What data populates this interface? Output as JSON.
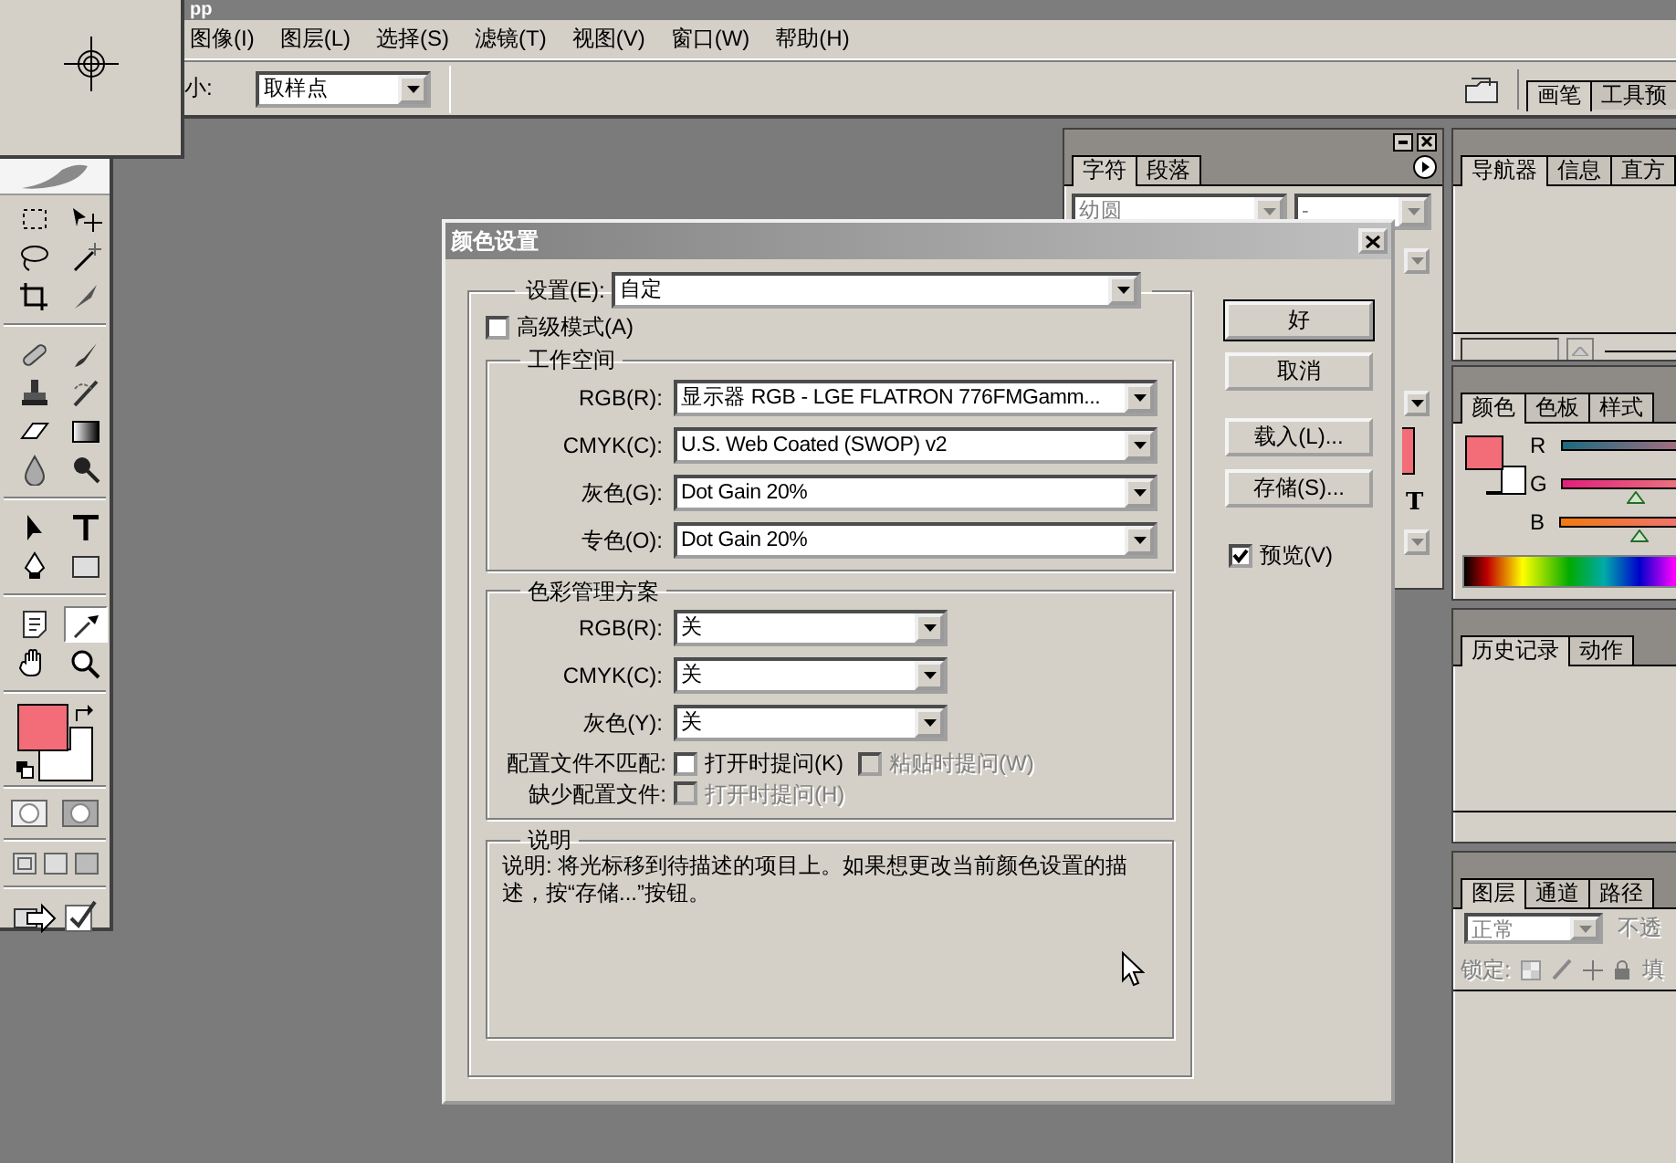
{
  "app_title": "pp",
  "menu": [
    "图像(I)",
    "图层(L)",
    "选择(S)",
    "滤镜(T)",
    "视图(V)",
    "窗口(W)",
    "帮助(H)"
  ],
  "options_bar": {
    "label": "小:",
    "sample_size": "取样点",
    "palette_tabs": [
      {
        "label": "画笔",
        "selected": true
      },
      {
        "label": "工具预",
        "selected": false
      }
    ]
  },
  "toolbox": {
    "tools": [
      {
        "selected": false
      },
      {
        "selected": false
      },
      {
        "selected": false
      },
      {
        "selected": false
      },
      {
        "selected": false
      },
      {
        "selected": false
      },
      {
        "selected": false
      },
      {
        "selected": false
      },
      {
        "selected": false
      },
      {
        "selected": false
      },
      {
        "selected": false
      },
      {
        "selected": false
      },
      {
        "selected": false
      },
      {
        "selected": false
      },
      {
        "selected": false
      },
      {
        "selected": false
      },
      {
        "selected": false
      },
      {
        "selected": false
      },
      {
        "selected": false
      },
      {
        "selected": true
      },
      {
        "selected": false
      },
      {
        "selected": false
      }
    ]
  },
  "character_panel": {
    "tabs": [
      {
        "label": "字符",
        "selected": true
      },
      {
        "label": "段落",
        "selected": false
      }
    ],
    "font_family": "幼圆",
    "font_style": "-",
    "style_button": "T"
  },
  "navigator_panel": {
    "tabs": [
      {
        "label": "导航器",
        "selected": true
      },
      {
        "label": "信息",
        "selected": false
      },
      {
        "label": "直方",
        "selected": false
      }
    ]
  },
  "color_panel": {
    "tabs": [
      {
        "label": "颜色",
        "selected": true
      },
      {
        "label": "色板",
        "selected": false
      },
      {
        "label": "样式",
        "selected": false
      }
    ],
    "sliders": [
      {
        "label": "R"
      },
      {
        "label": "G",
        "level": 0.4
      },
      {
        "label": "B",
        "level": 0.44
      }
    ]
  },
  "history_panel": {
    "tabs": [
      {
        "label": "历史记录",
        "selected": true
      },
      {
        "label": "动作",
        "selected": false
      }
    ]
  },
  "layers_panel": {
    "tabs": [
      {
        "label": "图层",
        "selected": true
      },
      {
        "label": "通道",
        "selected": false
      },
      {
        "label": "路径",
        "selected": false
      }
    ],
    "blend_mode": "正常",
    "opacity_label": "不透",
    "lock_label": "锁定:",
    "fill_label": "填"
  },
  "dialog": {
    "title": "颜色设置",
    "settings": {
      "label": "设置(E):",
      "value": "自定"
    },
    "advanced_mode": {
      "label": "高级模式(A)",
      "checked": false
    },
    "working_spaces": {
      "title": "工作空间",
      "rows": [
        {
          "label": "RGB(R):",
          "value": "显示器 RGB - LGE FLATRON 776FMGamm..."
        },
        {
          "label": "CMYK(C):",
          "value": "U.S. Web Coated (SWOP) v2"
        },
        {
          "label": "灰色(G):",
          "value": "Dot Gain 20%"
        },
        {
          "label": "专色(O):",
          "value": "Dot Gain 20%"
        }
      ]
    },
    "policies": {
      "title": "色彩管理方案",
      "rows": [
        {
          "label": "RGB(R):",
          "value": "关"
        },
        {
          "label": "CMYK(C):",
          "value": "关"
        },
        {
          "label": "灰色(Y):",
          "value": "关"
        }
      ],
      "mismatch": {
        "label": "配置文件不匹配:",
        "options": [
          {
            "label": "打开时提问(K)",
            "checked": false,
            "disabled": false
          },
          {
            "label": "粘贴时提问(W)",
            "checked": false,
            "disabled": true
          }
        ]
      },
      "missing": {
        "label": "缺少配置文件:",
        "options": [
          {
            "label": "打开时提问(H)",
            "checked": false,
            "disabled": true
          }
        ]
      }
    },
    "description": {
      "title": "说明",
      "text": "说明: 将光标移到待描述的项目上。如果想更改当前颜色设置的描述，按“存储...”按钮。"
    },
    "buttons": [
      {
        "label": "好",
        "is_default": true
      },
      {
        "label": "取消",
        "is_default": false
      },
      {
        "label": "载入(L)...",
        "is_default": false
      },
      {
        "label": "存储(S)...",
        "is_default": false
      }
    ],
    "preview": {
      "label": "预览(V)",
      "checked": true
    }
  }
}
